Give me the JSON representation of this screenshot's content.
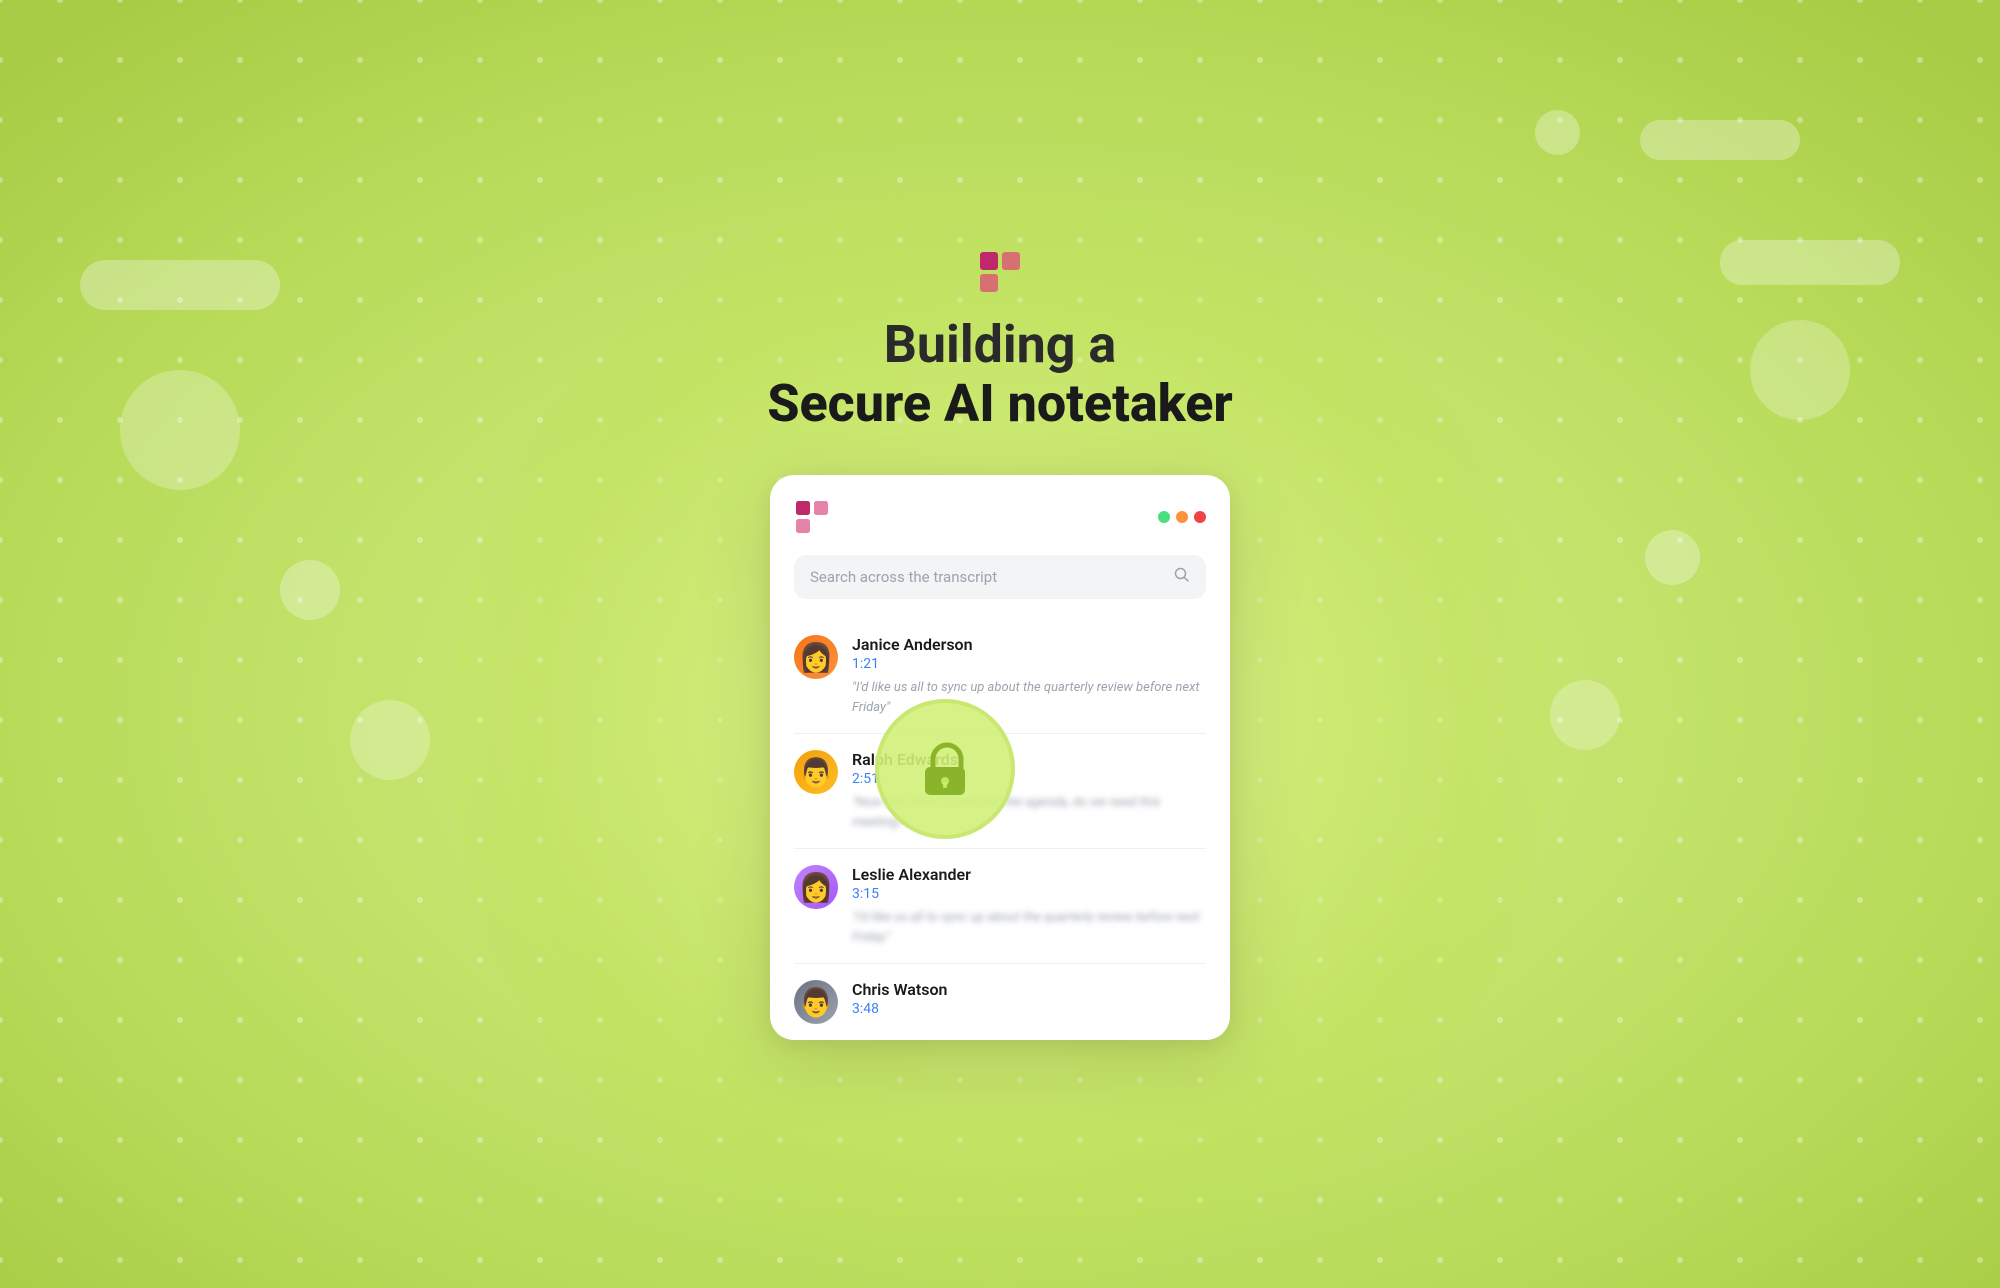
{
  "page": {
    "background_color": "#c8e87a",
    "title_line1": "Building a",
    "title_line2": "Secure AI notetaker"
  },
  "logo": {
    "alt": "Tally logo"
  },
  "card": {
    "traffic_lights": [
      "green",
      "orange",
      "red"
    ]
  },
  "search": {
    "placeholder": "Search across the transcript",
    "icon": "search"
  },
  "conversations": [
    {
      "name": "Janice Anderson",
      "time": "1:21",
      "text": "\"I'd like us all to sync up about the quarterly review before next Friday\""
    },
    {
      "name": "Ralph Edwards",
      "time": "2:51",
      "text": "\"Now that we've confirmed the agenda, do we need this meeting?\""
    },
    {
      "name": "Leslie Alexander",
      "time": "3:15",
      "text": "\"I'd like us all to sync up about the quarterly review before next Friday\""
    },
    {
      "name": "Chris Watson",
      "time": "3:48",
      "text": ""
    }
  ],
  "lock": {
    "label": "secure lock icon"
  }
}
